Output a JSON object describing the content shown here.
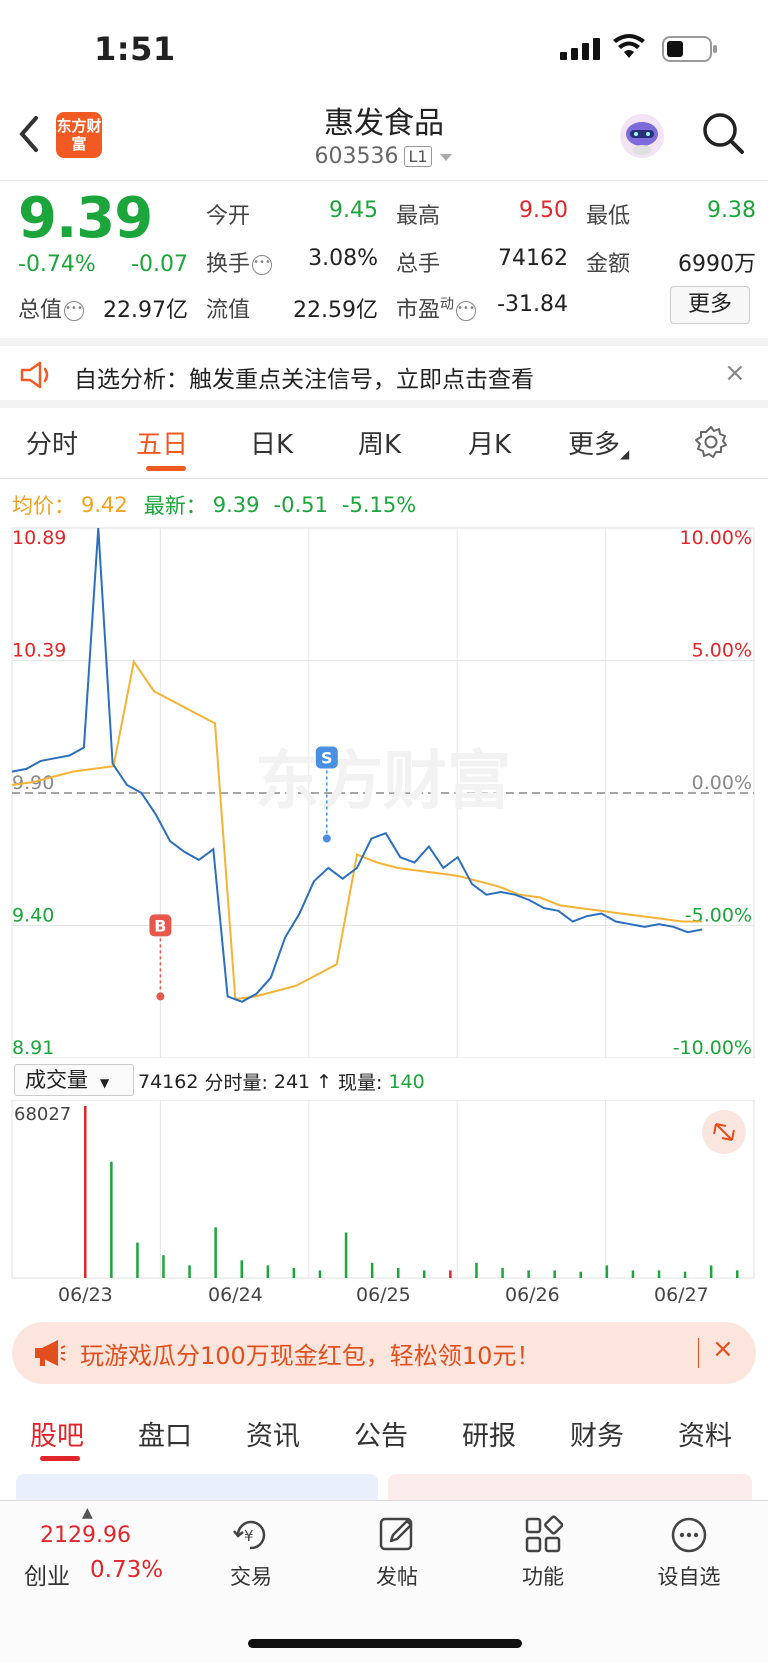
{
  "status_bar": {
    "time": "1:51"
  },
  "header": {
    "brand_logo": "东方财富",
    "stock_name": "惠发食品",
    "stock_code": "603536",
    "level": "L1"
  },
  "quote": {
    "last_price": "9.39",
    "change_pct": "-0.74%",
    "change_abs": "-0.07",
    "open_label": "今开",
    "open": "9.45",
    "high_label": "最高",
    "high": "9.50",
    "low_label": "最低",
    "low": "9.38",
    "turnover_label": "换手",
    "turnover": "3.08%",
    "volume_label": "总手",
    "volume": "74162",
    "amount_label": "金额",
    "amount": "6990万",
    "mktcap_label": "总值",
    "mktcap": "22.97亿",
    "float_label": "流值",
    "float_cap": "22.59亿",
    "pe_label": "市盈",
    "pe_sup": "动",
    "pe": "-31.84",
    "more_label": "更多"
  },
  "notice": {
    "text": "自选分析：触发重点关注信号，立即点击查看",
    "close": "×"
  },
  "chart_tabs": [
    "分时",
    "五日",
    "日K",
    "周K",
    "月K",
    "更多"
  ],
  "avg_row": {
    "avg_label": "均价：",
    "avg_value": "9.42",
    "latest_label": "最新：",
    "latest_value": "9.39",
    "latest_change": "-0.51",
    "latest_pct": "-5.15%"
  },
  "chart_data": {
    "type": "line",
    "x": [
      "06/23",
      "06/24",
      "06/25",
      "06/26",
      "06/27"
    ],
    "ylim": [
      8.91,
      10.89
    ],
    "y_ticks_left": [
      "10.89",
      "10.39",
      "9.90",
      "9.40",
      "8.91"
    ],
    "y_ticks_right": [
      "10.00%",
      "5.00%",
      "0.00%",
      "-5.00%",
      "-10.00%"
    ],
    "series": [
      {
        "values": [
          9.98,
          9.99,
          10.02,
          10.03,
          10.04,
          10.07,
          10.89,
          10.01,
          9.93,
          9.9,
          9.82,
          9.72,
          9.68,
          9.65,
          9.69,
          9.14,
          9.12,
          9.15,
          9.21,
          9.36,
          9.45,
          9.57,
          9.62,
          9.58,
          9.62,
          9.73,
          9.75,
          9.66,
          9.64,
          9.7,
          9.62,
          9.66,
          9.56,
          9.52,
          9.53,
          9.52,
          9.5,
          9.47,
          9.46,
          9.42,
          9.44,
          9.45,
          9.42,
          9.41,
          9.4,
          9.41,
          9.4,
          9.38,
          9.39
        ]
      },
      {
        "values": [
          9.93,
          9.94,
          9.96,
          9.98,
          9.99,
          10.0,
          10.39,
          10.28,
          10.24,
          10.2,
          10.16,
          9.13,
          9.14,
          9.16,
          9.18,
          9.22,
          9.26,
          9.67,
          9.64,
          9.62,
          9.61,
          9.6,
          9.59,
          9.57,
          9.55,
          9.52,
          9.51,
          9.48,
          9.47,
          9.46,
          9.45,
          9.44,
          9.43,
          9.42,
          9.42
        ]
      }
    ],
    "markers": [
      {
        "label": "B",
        "x": "06/23",
        "y": 9.14
      },
      {
        "label": "S",
        "x": "06/24",
        "y": 9.73
      }
    ],
    "watermark": "东方财富"
  },
  "volume": {
    "selector": "成交量",
    "total": "74162",
    "minute_label": "分时量:",
    "minute_value": "241",
    "arrow": "↑",
    "current_label": "现量:",
    "current_value": "140",
    "max_tick": "68027"
  },
  "volume_chart": {
    "type": "bar",
    "values": [
      68027,
      46000,
      14000,
      9000,
      5000,
      20000,
      7000,
      5000,
      4000,
      3000,
      18000,
      6000,
      4000,
      3000,
      3000,
      6000,
      4000,
      3000,
      3000,
      2500,
      5000,
      3000,
      3000,
      2500,
      5000,
      3000
    ]
  },
  "promo": {
    "text": "玩游戏瓜分100万现金红包，轻松领10元！",
    "close": "×"
  },
  "section_tabs": [
    "股吧",
    "盘口",
    "资讯",
    "公告",
    "研报",
    "财务",
    "资料"
  ],
  "bottom_nav": {
    "index_value": "2129.96",
    "index_name": "创业",
    "index_change": "0.73%",
    "items": [
      "交易",
      "发帖",
      "功能",
      "设自选"
    ]
  }
}
